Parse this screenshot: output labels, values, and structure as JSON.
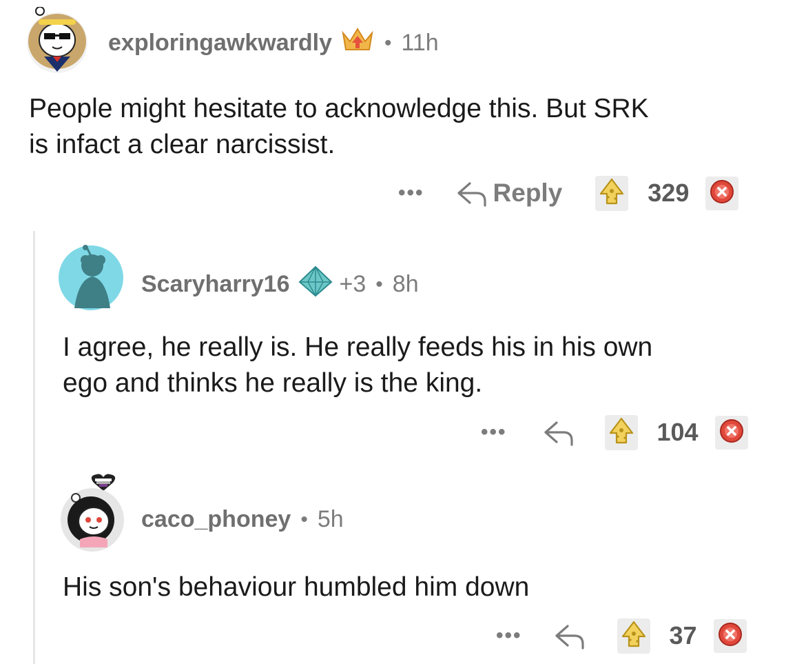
{
  "comments": [
    {
      "username": "exploringawkwardly",
      "flair_icon": "upvote-crown-icon",
      "separator": "•",
      "time": "11h",
      "text_line1": "People might hesitate to acknowledge this. But SRK",
      "text_line2": "is infact a clear narcissist.",
      "more_label": "•••",
      "reply_label": "Reply",
      "score": "329"
    },
    {
      "username": "Scaryharry16",
      "flair_icon": "diamond-pyramid-icon",
      "award_count": "+3",
      "separator": "•",
      "time": "8h",
      "text_line1": "I agree, he really is. He really feeds his in his own",
      "text_line2": "ego and thinks he really is the king.",
      "more_label": "•••",
      "score": "104"
    },
    {
      "username": "caco_phoney",
      "separator": "•",
      "time": "5h",
      "text_line1": "His son's behaviour humbled him down",
      "more_label": "•••",
      "score": "37"
    }
  ],
  "colors": {
    "text": "#1a1a1b",
    "meta": "#7c7c7c",
    "thread_line": "#e6e6e6",
    "avatar_blue": "#7fd8e6",
    "downvote_red": "#e0483b",
    "upvote_yellow": "#f2d15c"
  }
}
